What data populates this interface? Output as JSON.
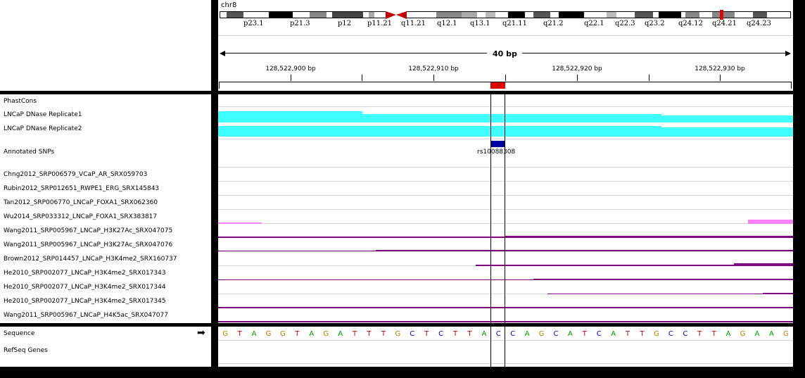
{
  "chromosome": "chr8",
  "ideogram": {
    "bands": [
      "p23.1",
      "p21.3",
      "p12",
      "p11.21",
      "q11.21",
      "q12.1",
      "q13.1",
      "q21.11",
      "q21.2",
      "q22.1",
      "q22.3",
      "q23.2",
      "q24.12",
      "q24.21",
      "q24.23"
    ]
  },
  "ruler": {
    "span_label": "40 bp",
    "ticks": [
      "128,522,900 bp",
      "128,522,910 bp",
      "128,522,920 bp",
      "128,522,930 bp"
    ]
  },
  "tracks": [
    {
      "label": "PhastCons"
    },
    {
      "label": "LNCaP DNase Replicate1"
    },
    {
      "label": "LNCaP DNase Replicate2"
    },
    {
      "label": "Annotated SNPs"
    },
    {
      "label": "Chng2012_SRP006579_VCaP_AR_SRX059703"
    },
    {
      "label": "Rubin2012_SRP012651_RWPE1_ERG_SRX145843"
    },
    {
      "label": "Tan2012_SRP006770_LNCaP_FOXA1_SRX062360"
    },
    {
      "label": "Wu2014_SRP033312_LNCaP_FOXA1_SRX383817"
    },
    {
      "label": "Wang2011_SRP005967_LNCaP_H3K27Ac_SRX047075"
    },
    {
      "label": "Wang2011_SRP005967_LNCaP_H3K27Ac_SRX047076"
    },
    {
      "label": "Brown2012_SRP014457_LNCaP_H3K4me2_SRX160737"
    },
    {
      "label": "He2010_SRP002077_LNCaP_H3K4me2_SRX017343"
    },
    {
      "label": "He2010_SRP002077_LNCaP_H3K4me2_SRX017344"
    },
    {
      "label": "He2010_SRP002077_LNCaP_H3K4me2_SRX017345"
    },
    {
      "label": "Wang2011_SRP005967_LNCaP_H4K5ac_SRX047077"
    }
  ],
  "snp_label": "rs10088308",
  "bottom_tracks": {
    "sequence_label": "Sequence",
    "sequence_arrow": "➡",
    "refseq_label": "RefSeq Genes"
  },
  "sequence": [
    "G",
    "T",
    "A",
    "G",
    "G",
    "T",
    "A",
    "G",
    "A",
    "T",
    "T",
    "T",
    "G",
    "C",
    "T",
    "C",
    "T",
    "T",
    "A",
    "C",
    "C",
    "A",
    "G",
    "C",
    "A",
    "T",
    "C",
    "A",
    "T",
    "T",
    "G",
    "C",
    "C",
    "T",
    "T",
    "A",
    "G",
    "A",
    "A",
    "G"
  ],
  "colors": {
    "A": "#00a000",
    "C": "#0000e0",
    "G": "#c07800",
    "T": "#e00000",
    "dnase": "#40ffff",
    "chip": "#800080",
    "foxa1": "#ff80ff",
    "snp": "#0000a0",
    "highlight": "#ff0000"
  }
}
